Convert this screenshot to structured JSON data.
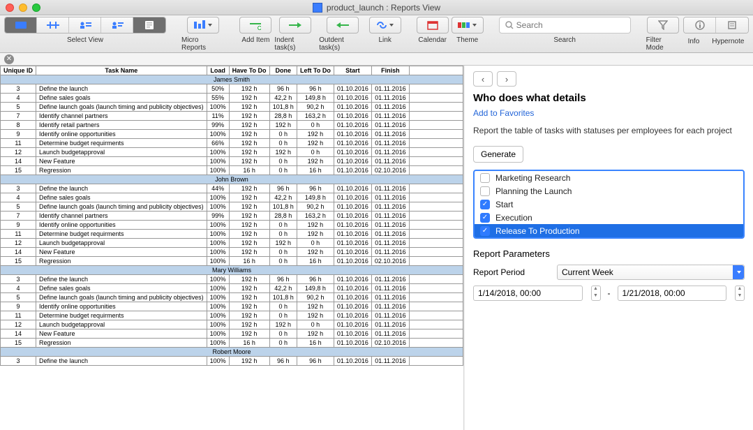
{
  "window": {
    "title": "product_launch : Reports View"
  },
  "toolbar": {
    "selectView": "Select View",
    "microReports": "Micro Reports",
    "addItem": "Add Item",
    "indent": "Indent task(s)",
    "outdent": "Outdent task(s)",
    "link": "Link",
    "calendar": "Calendar",
    "theme": "Theme",
    "search": "Search",
    "searchPlaceholder": "Search",
    "filterMode": "Filter Mode",
    "info": "Info",
    "hypernote": "Hypernote"
  },
  "report": {
    "columns": {
      "uid": "Unique ID",
      "task": "Task Name",
      "load": "Load",
      "htd": "Have To Do",
      "done": "Done",
      "ltd": "Left To Do",
      "start": "Start",
      "finish": "Finish"
    },
    "groups": [
      {
        "name": "James Smith",
        "rows": [
          {
            "id": "3",
            "task": "Define the launch",
            "load": "50%",
            "htd": "192 h",
            "done": "96 h",
            "ltd": "96 h",
            "start": "01.10.2016",
            "finish": "01.11.2016"
          },
          {
            "id": "4",
            "task": "Define sales goals",
            "load": "55%",
            "htd": "192 h",
            "done": "42,2 h",
            "ltd": "149,8 h",
            "start": "01.10.2016",
            "finish": "01.11.2016"
          },
          {
            "id": "5",
            "task": "Define launch goals (launch timing and publicity objectives)",
            "load": "100%",
            "htd": "192 h",
            "done": "101,8 h",
            "ltd": "90,2 h",
            "start": "01.10.2016",
            "finish": "01.11.2016"
          },
          {
            "id": "7",
            "task": "Identify channel partners",
            "load": "11%",
            "htd": "192 h",
            "done": "28,8 h",
            "ltd": "163,2 h",
            "start": "01.10.2016",
            "finish": "01.11.2016"
          },
          {
            "id": "8",
            "task": "Identify retail partners",
            "load": "99%",
            "htd": "192 h",
            "done": "192 h",
            "ltd": "0 h",
            "start": "01.10.2016",
            "finish": "01.11.2016"
          },
          {
            "id": "9",
            "task": "Identify online opportunities",
            "load": "100%",
            "htd": "192 h",
            "done": "0 h",
            "ltd": "192 h",
            "start": "01.10.2016",
            "finish": "01.11.2016"
          },
          {
            "id": "11",
            "task": "Determine budget requirments",
            "load": "66%",
            "htd": "192 h",
            "done": "0 h",
            "ltd": "192 h",
            "start": "01.10.2016",
            "finish": "01.11.2016"
          },
          {
            "id": "12",
            "task": "Launch budgetapproval",
            "load": "100%",
            "htd": "192 h",
            "done": "192 h",
            "ltd": "0 h",
            "start": "01.10.2016",
            "finish": "01.11.2016"
          },
          {
            "id": "14",
            "task": "New Feature",
            "load": "100%",
            "htd": "192 h",
            "done": "0 h",
            "ltd": "192 h",
            "start": "01.10.2016",
            "finish": "01.11.2016"
          },
          {
            "id": "15",
            "task": "Regression",
            "load": "100%",
            "htd": "16 h",
            "done": "0 h",
            "ltd": "16 h",
            "start": "01.10.2016",
            "finish": "02.10.2016"
          }
        ]
      },
      {
        "name": "John Brown",
        "rows": [
          {
            "id": "3",
            "task": "Define the launch",
            "load": "44%",
            "htd": "192 h",
            "done": "96 h",
            "ltd": "96 h",
            "start": "01.10.2016",
            "finish": "01.11.2016"
          },
          {
            "id": "4",
            "task": "Define sales goals",
            "load": "100%",
            "htd": "192 h",
            "done": "42,2 h",
            "ltd": "149,8 h",
            "start": "01.10.2016",
            "finish": "01.11.2016"
          },
          {
            "id": "5",
            "task": "Define launch goals (launch timing and publicity objectives)",
            "load": "100%",
            "htd": "192 h",
            "done": "101,8 h",
            "ltd": "90,2 h",
            "start": "01.10.2016",
            "finish": "01.11.2016"
          },
          {
            "id": "7",
            "task": "Identify channel partners",
            "load": "99%",
            "htd": "192 h",
            "done": "28,8 h",
            "ltd": "163,2 h",
            "start": "01.10.2016",
            "finish": "01.11.2016"
          },
          {
            "id": "9",
            "task": "Identify online opportunities",
            "load": "100%",
            "htd": "192 h",
            "done": "0 h",
            "ltd": "192 h",
            "start": "01.10.2016",
            "finish": "01.11.2016"
          },
          {
            "id": "11",
            "task": "Determine budget requirments",
            "load": "100%",
            "htd": "192 h",
            "done": "0 h",
            "ltd": "192 h",
            "start": "01.10.2016",
            "finish": "01.11.2016"
          },
          {
            "id": "12",
            "task": "Launch budgetapproval",
            "load": "100%",
            "htd": "192 h",
            "done": "192 h",
            "ltd": "0 h",
            "start": "01.10.2016",
            "finish": "01.11.2016"
          },
          {
            "id": "14",
            "task": "New Feature",
            "load": "100%",
            "htd": "192 h",
            "done": "0 h",
            "ltd": "192 h",
            "start": "01.10.2016",
            "finish": "01.11.2016"
          },
          {
            "id": "15",
            "task": "Regression",
            "load": "100%",
            "htd": "16 h",
            "done": "0 h",
            "ltd": "16 h",
            "start": "01.10.2016",
            "finish": "02.10.2016"
          }
        ]
      },
      {
        "name": "Mary Williams",
        "rows": [
          {
            "id": "3",
            "task": "Define the launch",
            "load": "100%",
            "htd": "192 h",
            "done": "96 h",
            "ltd": "96 h",
            "start": "01.10.2016",
            "finish": "01.11.2016"
          },
          {
            "id": "4",
            "task": "Define sales goals",
            "load": "100%",
            "htd": "192 h",
            "done": "42,2 h",
            "ltd": "149,8 h",
            "start": "01.10.2016",
            "finish": "01.11.2016"
          },
          {
            "id": "5",
            "task": "Define launch goals (launch timing and publicity objectives)",
            "load": "100%",
            "htd": "192 h",
            "done": "101,8 h",
            "ltd": "90,2 h",
            "start": "01.10.2016",
            "finish": "01.11.2016"
          },
          {
            "id": "9",
            "task": "Identify online opportunities",
            "load": "100%",
            "htd": "192 h",
            "done": "0 h",
            "ltd": "192 h",
            "start": "01.10.2016",
            "finish": "01.11.2016"
          },
          {
            "id": "11",
            "task": "Determine budget requirments",
            "load": "100%",
            "htd": "192 h",
            "done": "0 h",
            "ltd": "192 h",
            "start": "01.10.2016",
            "finish": "01.11.2016"
          },
          {
            "id": "12",
            "task": "Launch budgetapproval",
            "load": "100%",
            "htd": "192 h",
            "done": "192 h",
            "ltd": "0 h",
            "start": "01.10.2016",
            "finish": "01.11.2016"
          },
          {
            "id": "14",
            "task": "New Feature",
            "load": "100%",
            "htd": "192 h",
            "done": "0 h",
            "ltd": "192 h",
            "start": "01.10.2016",
            "finish": "01.11.2016"
          },
          {
            "id": "15",
            "task": "Regression",
            "load": "100%",
            "htd": "16 h",
            "done": "0 h",
            "ltd": "16 h",
            "start": "01.10.2016",
            "finish": "02.10.2016"
          }
        ]
      },
      {
        "name": "Robert Moore",
        "rows": [
          {
            "id": "3",
            "task": "Define the launch",
            "load": "100%",
            "htd": "192 h",
            "done": "96 h",
            "ltd": "96 h",
            "start": "01.10.2016",
            "finish": "01.11.2016"
          }
        ]
      }
    ]
  },
  "panel": {
    "title": "Who does what details",
    "favorites": "Add to Favorites",
    "description": "Report the table of tasks with statuses per employees for each project",
    "generate": "Generate",
    "checklist": [
      {
        "label": "Marketing Research",
        "checked": false,
        "selected": false
      },
      {
        "label": "Planning the Launch",
        "checked": false,
        "selected": false
      },
      {
        "label": "Start",
        "checked": true,
        "selected": false
      },
      {
        "label": "Execution",
        "checked": true,
        "selected": false
      },
      {
        "label": "Release To Production",
        "checked": true,
        "selected": true
      }
    ],
    "paramsTitle": "Report Parameters",
    "periodLabel": "Report Period",
    "periodValue": "Current Week",
    "dateFrom": "1/14/2018, 00:00",
    "dateSeparator": "-",
    "dateTo": "1/21/2018, 00:00"
  }
}
